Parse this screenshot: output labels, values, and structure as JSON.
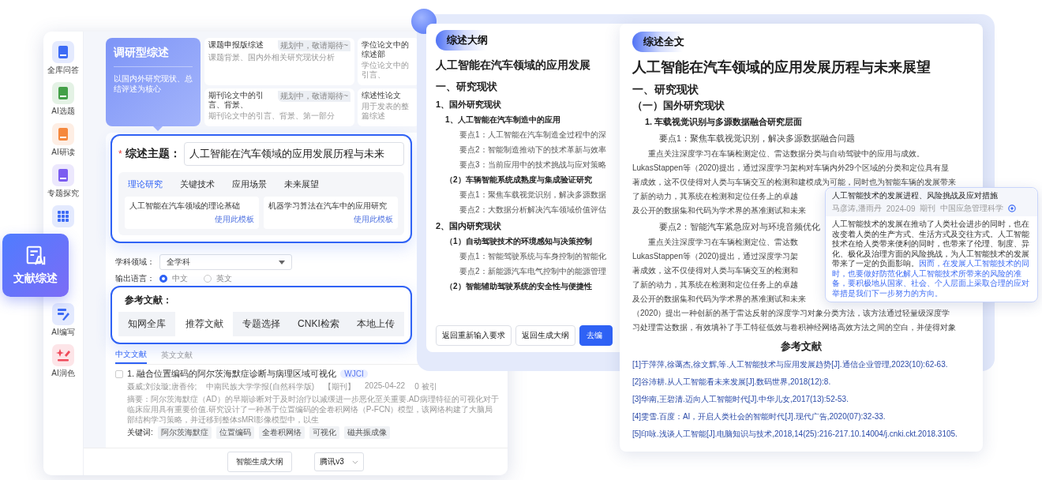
{
  "sidebar": {
    "items": [
      {
        "label": "全库问答",
        "kind": "doc",
        "color": "#3d6bf5",
        "selected": false
      },
      {
        "label": "AI选题",
        "kind": "doc",
        "color": "#43a047",
        "selected": false
      },
      {
        "label": "AI研读",
        "kind": "doc",
        "color": "#f5883d",
        "selected": false
      },
      {
        "label": "专题探究",
        "kind": "doc",
        "color": "#7b5cf0",
        "selected": false
      },
      {
        "kind": "grid",
        "color": "#3d6bf5",
        "selected": false
      },
      {
        "label": "文献综述",
        "selected": true
      },
      {
        "label": "AI编写",
        "kind": "pen",
        "color": "#3d6bf5",
        "selected": false
      },
      {
        "label": "AI润色",
        "kind": "sparkle",
        "color": "#f04a5a",
        "selected": false
      }
    ]
  },
  "review_types": {
    "main": {
      "title": "调研型综述",
      "description": "以国内外研究现状、总结评述为核心"
    },
    "cards": [
      {
        "title": "课题申报版综述",
        "subtitle": "课题背景、国内外相关研究现状分析",
        "badge": "规划中，敬请期待~"
      },
      {
        "title": "学位论文中的综述部",
        "subtitle": "学位论文中的引言、"
      },
      {
        "title": "期刊论文中的引言、背景、",
        "subtitle": "期刊论文中的引言、背景、第一部分",
        "badge": "规划中，敬请期待~"
      },
      {
        "title": "综述性论文",
        "subtitle": "用于发表的整篇综述"
      }
    ]
  },
  "topic": {
    "required_mark": "*",
    "label": "综述主题：",
    "value": "人工智能在汽车领域的应用发展历程与未来"
  },
  "template_tabs": [
    {
      "label": "理论研究",
      "selected": true
    },
    {
      "label": "关键技术",
      "selected": false
    },
    {
      "label": "应用场景",
      "selected": false
    },
    {
      "label": "未来展望",
      "selected": false
    }
  ],
  "templates": [
    {
      "title": "人工智能在汽车领域的理论基础",
      "action": "使用此模板"
    },
    {
      "title": "机器学习算法在汽车中的应用研究",
      "action": "使用此模板"
    }
  ],
  "subject": {
    "label": "学科领域：",
    "value": "全学科"
  },
  "output_language": {
    "label": "输出语言：",
    "options": [
      {
        "label": "中文",
        "selected": true
      },
      {
        "label": "英文",
        "selected": false
      }
    ]
  },
  "reference_source": {
    "label": "参考文献：",
    "tabs": [
      {
        "label": "知网全库",
        "selected": false
      },
      {
        "label": "推荐文献",
        "selected": true
      },
      {
        "label": "专题选择",
        "selected": false
      },
      {
        "label": "CNKI检索",
        "selected": false
      },
      {
        "label": "本地上传",
        "selected": false
      }
    ]
  },
  "literature_tabs": [
    {
      "label": "中文文献",
      "selected": true
    },
    {
      "label": "英文文献",
      "selected": false
    }
  ],
  "results": [
    {
      "checked": false,
      "number": "1.",
      "title": "融合位置编码的阿尔茨海默症诊断与病理区域可视化",
      "badge": "WJCI",
      "authors": "聂威;刘汝璇;唐香伶;",
      "source": "中南民族大学学报(自然科学版)",
      "type": "【期刊】",
      "date": "2025-04-22",
      "citations": "0 被引",
      "abstract": "摘要：阿尔茨海默症（AD）的早期诊断对于及时治疗以减缓进一步恶化至关重要.AD病理特征的可视化对于临床应用具有重要价值.研究设计了一种基于位置编码的全卷积网络（P-FCN）模型，该网络构建了大脑局部结构学习策略，并迁移到整体sMRI影像模型中，以生",
      "keywords_label": "关键词:",
      "keywords": [
        "阿尔茨海默症",
        "位置编码",
        "全卷积网络",
        "可视化",
        "磁共振成像"
      ]
    }
  ],
  "footer": {
    "generate_button": "智能生成大纲",
    "model": "腾讯v3"
  },
  "outline": {
    "label": "综述大纲",
    "title": "人工智能在汽车领域的应用发展",
    "items": [
      {
        "text": "一、研究现状",
        "children": [
          {
            "text": "1、国外研究现状",
            "children": [
              {
                "text": "1、人工智能在汽车制造中的应用",
                "children": [
                  {
                    "text": "要点1：人工智能在汽车制造全过程中的深"
                  },
                  {
                    "text": "要点2：智能制造推动下的技术革新与效率"
                  },
                  {
                    "text": "要点3：当前应用中的技术挑战与应对策略"
                  }
                ]
              },
              {
                "text": "（2）车辆智能系统成熟度与集成验证研究",
                "children": [
                  {
                    "text": "要点1：聚焦车载视觉识别，解决多源数据"
                  },
                  {
                    "text": "要点2：大数据分析解决汽车领域价值评估"
                  }
                ]
              }
            ]
          },
          {
            "text": "2、国内研究现状",
            "children": [
              {
                "text": "（1）自动驾驶技术的环境感知与决策控制",
                "children": [
                  {
                    "text": "要点1：智能驾驶系统与车身控制的智能化"
                  },
                  {
                    "text": "要点2：新能源汽车电气控制中的能源管理"
                  }
                ]
              },
              {
                "text": "（2）智能辅助驾驶系统的安全性与便捷性"
              }
            ]
          }
        ]
      }
    ],
    "buttons": [
      {
        "label": "返回重新输入要求",
        "primary": false
      },
      {
        "label": "返回生成大纲",
        "primary": false
      },
      {
        "label": "去编",
        "primary": true
      }
    ]
  },
  "full_text": {
    "label": "综述全文",
    "title": "人工智能在汽车领域的应用发展历程与未来展望",
    "items": [
      {
        "text": "一、研究现状",
        "children": [
          {
            "text": "（一）国外研究现状",
            "children": [
              {
                "text": "1. 车载视觉识别与多源数据融合研究层面",
                "children": [
                  {
                    "text": "要点1：聚焦车载视觉识别，解决多源数据融合问题",
                    "lines": [
                      "重点关注深度学习在车辆检测定位、雷达数据分类与自动驾驶中的应用与成效。",
                      "LukasStappen等（2020)提出，通过深度学习架构对车辆内外29个区域的分类和定位具有显",
                      "著成效，这不仅使得对人类与车辆交互的检测和建模成为可能，同时也为智能车辆的发展带来",
                      "了新的动力，其系统在检测和定位任务上的卓越",
                      "及公开的数据集和代码为学术界的基准测试和未来"
                    ]
                  },
                  {
                    "text": "要点2：智能汽车紧急应对与环境音频优化",
                    "lines": [
                      "重点关注深度学习在车辆检测定位、雷达数",
                      "LukasStappen等（2020)提出，通过深度学习架",
                      "著成效，这不仅使得对人类与车辆交互的检测和",
                      "了新的动力，其系统在检测和定位任务上的卓越",
                      "及公开的数据集和代码为学术界的基准测试和未来",
                      "（2020）提出一种创新的基于雷达反射的深度学习对象分类方法，该方法通过轻量级深度学",
                      "习处理雷达数据，有效填补了手工特征低效与卷积神经网络高效方法之间的空白，并使得对象"
                    ]
                  }
                ]
              }
            ]
          }
        ]
      }
    ],
    "references": {
      "title": "参考文献",
      "items": [
        "[1]于萍萍,徐蔼杰,徐文辉,等.人工智能技术与应用发展趋势[J].通信企业管理,2023(10):62-63.",
        "[2]谷沛耕.从人工智能看未来发展[J].数码世界,2018(12):8.",
        "[3]华南,王碧清.迈向人工智能时代[J].中华儿女,2017(13):52-53.",
        "[4]雯雪.百度：AI，开启人类社会的智能时代[J].现代广告,2020(07):32-33.",
        "[5]印咏.浅谈人工智能[J].电脑知识与技术,2018,14(25):216-217.10.14004/j.cnki.ckt.2018.3105."
      ]
    }
  },
  "citation_popup": {
    "title": "人工智能技术的发展进程、风险挑战及应对措施",
    "authors": "马彦涛,潘雨丹",
    "date": "2024-09",
    "type": "期刊",
    "source": "中国应急管理科学",
    "abstract": [
      {
        "text": "人工智能技术的发展在推动了人类社会进步的同时，也在改变着人类的生产方式、生活方式及交往方式。人工智能技术在给人类带来便利的同时，也带来了伦理、制度、异化、极化及治理方面的风险挑战，为人工智能技术的发展带来了一定的负面影响。",
        "highlighted": false
      },
      {
        "text": "因而，在发展人工智能技术的同时，也要做好防范化解人工智能技术所带来的风险的准备，要积极地从国家、社会、个人层面上采取合理的应对举措是我们下一步努力的方向。",
        "highlighted": true
      }
    ]
  }
}
